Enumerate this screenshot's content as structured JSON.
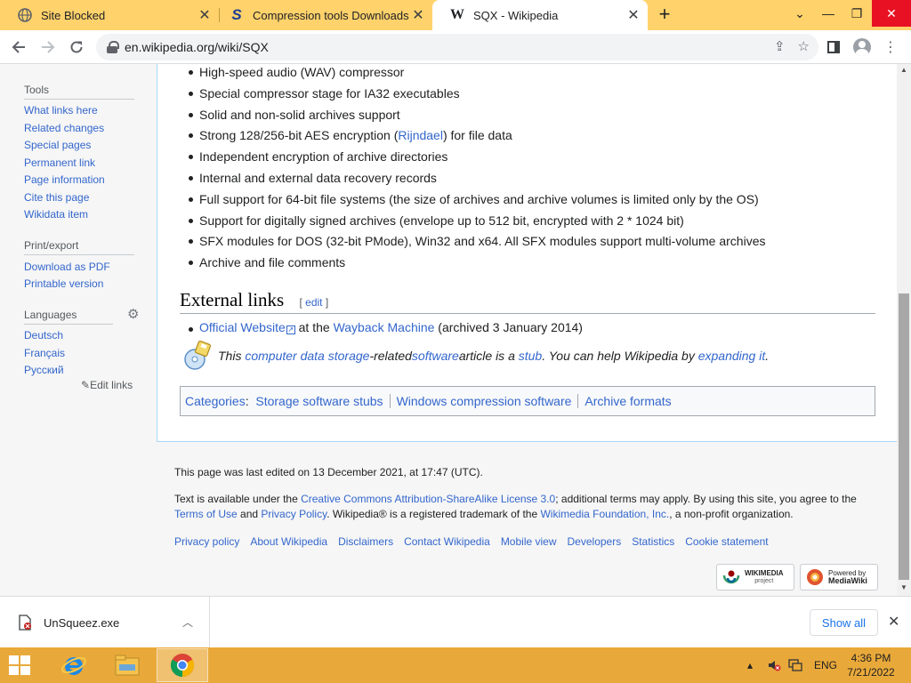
{
  "browser": {
    "tabs": [
      {
        "title": "Site Blocked",
        "favicon": "globe-icon"
      },
      {
        "title": "Compression tools Downloads",
        "favicon": "softpedia-s-icon"
      },
      {
        "title": "SQX - Wikipedia",
        "favicon": "wikipedia-w-icon"
      }
    ],
    "url": "en.wikipedia.org/wiki/SQX"
  },
  "sidebar": {
    "tools_heading": "Tools",
    "tools": [
      "What links here",
      "Related changes",
      "Special pages",
      "Permanent link",
      "Page information",
      "Cite this page",
      "Wikidata item"
    ],
    "print_heading": "Print/export",
    "print": [
      "Download as PDF",
      "Printable version"
    ],
    "languages_heading": "Languages",
    "languages": [
      "Deutsch",
      "Français",
      "Русский"
    ],
    "edit_links": "Edit links"
  },
  "content": {
    "features": [
      "High-speed audio (WAV) compressor",
      "Special compressor stage for IA32 executables",
      "Solid and non-solid archives support",
      "Strong 128/256-bit AES encryption (",
      "Independent encryption of archive directories",
      "Internal and external data recovery records",
      "Full support for 64-bit file systems (the size of archives and archive volumes is limited only by the OS)",
      "Support for digitally signed archives (envelope up to 512 bit, encrypted with 2 * 1024 bit)",
      "SFX modules for DOS (32-bit PMode), Win32 and x64. All SFX modules support multi-volume archives",
      "Archive and file comments"
    ],
    "aes_link": "Rijndael",
    "aes_suffix": ") for file data",
    "external_heading": "External links",
    "edit_label": "edit",
    "official_link": "Official Website",
    "at_the": " at the ",
    "wayback_link": "Wayback Machine",
    "archived": " (archived 3 January 2014)",
    "stub_this": "This ",
    "stub_link1": "computer data storage",
    "stub_related": "-related ",
    "stub_link2": "software",
    "stub_article": " article is a ",
    "stub_link3": "stub",
    "stub_help": ". You can help Wikipedia by ",
    "stub_link4": "expanding it",
    "stub_end": ".",
    "categories_label": "Categories",
    "categories": [
      "Storage software stubs",
      "Windows compression software",
      "Archive formats"
    ]
  },
  "footer": {
    "last_edited": "This page was last edited on 13 December 2021, at 17:47 (UTC).",
    "license_1": "Text is available under the ",
    "license_link": "Creative Commons Attribution-ShareAlike License 3.0",
    "license_2": "; additional terms may apply. By using this site, you agree to the",
    "terms_link": "Terms of Use",
    "and": " and ",
    "privacy_link": "Privacy Policy",
    "trademark": ". Wikipedia® is a registered trademark of the ",
    "foundation_link": "Wikimedia Foundation, Inc.",
    "nonprofit": ", a non-profit organization.",
    "places": [
      "Privacy policy",
      "About Wikipedia",
      "Disclaimers",
      "Contact Wikipedia",
      "Mobile view",
      "Developers",
      "Statistics",
      "Cookie statement"
    ],
    "wikimedia_badge": [
      "WIKIMEDIA",
      "project"
    ],
    "mediawiki_badge": [
      "Powered by",
      "MediaWiki"
    ]
  },
  "downloads": {
    "file": "UnSqueez.exe",
    "show_all": "Show all"
  },
  "taskbar": {
    "language": "ENG",
    "time": "4:36 PM",
    "date": "7/21/2022"
  },
  "colors": {
    "tab_strip": "#ffd26b",
    "taskbar": "#e9a93a",
    "link": "#3366cc",
    "chrome_blue": "#1a73e8"
  }
}
